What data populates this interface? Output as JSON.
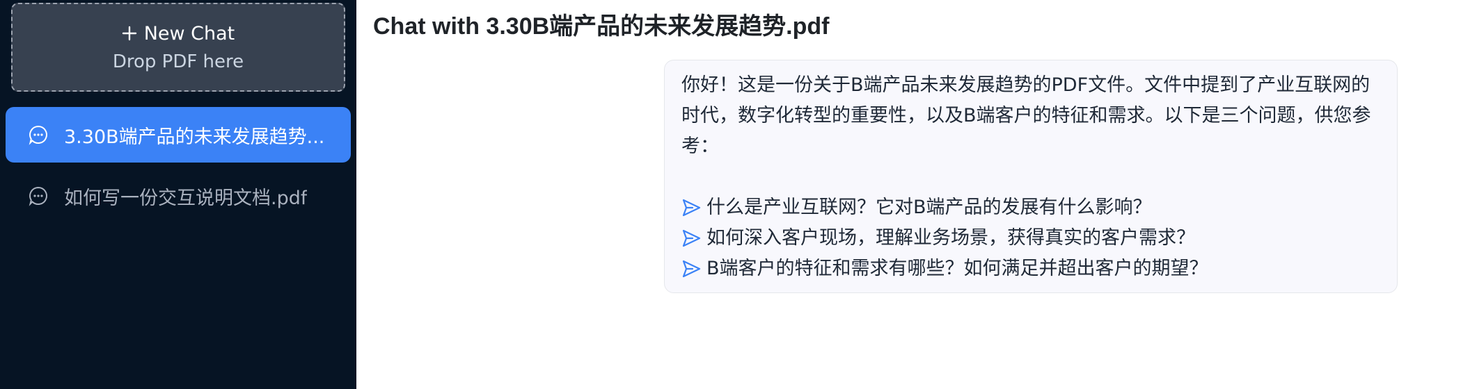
{
  "sidebar": {
    "new_chat": {
      "label": "New Chat",
      "drop_hint": "Drop PDF here"
    },
    "conversations": [
      {
        "label": "3.30B端产品的未来发展趋势...",
        "active": true
      },
      {
        "label": "如何写一份交互说明文档.pdf",
        "active": false
      }
    ]
  },
  "main": {
    "title": "Chat with 3.30B端产品的未来发展趋势.pdf",
    "message": {
      "intro": "你好！这是一份关于B端产品未来发展趋势的PDF文件。文件中提到了产业互联网的时代，数字化转型的重要性，以及B端客户的特征和需求。以下是三个问题，供您参考：",
      "questions": [
        "什么是产业互联网？它对B端产品的发展有什么影响？",
        "如何深入客户现场，理解业务场景，获得真实的客户需求？",
        "B端客户的特征和需求有哪些？如何满足并超出客户的期望？"
      ]
    }
  },
  "colors": {
    "sidebar_bg": "#061424",
    "new_chat_bg": "#374150",
    "active_item": "#3b82f6",
    "accent_icon": "#3b82f6"
  },
  "icons": {
    "new_chat": "plus-icon",
    "conversation": "chat-bubble-icon",
    "question": "send-icon"
  }
}
